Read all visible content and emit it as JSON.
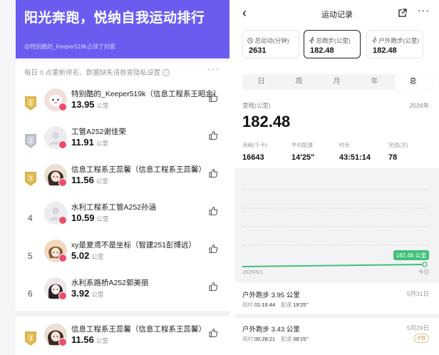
{
  "left": {
    "banner_title": "阳光奔跑，悦纳自我运动排行",
    "banner_sub": "@特别酷的_Keeper519k占领了封面",
    "list_header": "每日 0 点重新排名、数据缺失请核查隐私设置",
    "info_icon": "i",
    "more": "···",
    "medal_labels": [
      "1",
      "2",
      "3"
    ],
    "rows": [
      {
        "rank": "1",
        "name": "特别酷的_Keeper519k（信息工程系王昭金）",
        "value": "13.95",
        "unit": "公里"
      },
      {
        "rank": "2",
        "name": "工管A252谢佳荣",
        "value": "11.91",
        "unit": "公里"
      },
      {
        "rank": "3",
        "name": "信息工程系王蕊馨（信息工程系王蕊馨）",
        "value": "11.56",
        "unit": "公里"
      },
      {
        "rank": "4",
        "name": "水利工程系工管A252孙涵",
        "value": "10.59",
        "unit": "公里"
      },
      {
        "rank": "5",
        "name": "xy是夏鸢不是坐标（智建251彭博远）",
        "value": "5.02",
        "unit": "公里"
      },
      {
        "rank": "6",
        "name": "水利系路桥A252郭美丽",
        "value": "3.92",
        "unit": "公里"
      }
    ],
    "me": {
      "rank": "3",
      "name": "信息工程系王蕊馨（信息工程系王蕊馨）",
      "value": "11.56",
      "unit": "公里"
    },
    "colors": {
      "banner": "#6b5cf0",
      "gold": "#d9b44a",
      "silver": "#b8bcc6",
      "badge": "#ee4d6a"
    }
  },
  "right": {
    "nav": {
      "back": "‹",
      "title": "运动记录",
      "share_icon": "share-icon",
      "more": "···"
    },
    "stats": [
      {
        "label": "总运动(分钟)",
        "value": "2631",
        "icon": "clock-icon"
      },
      {
        "label": "总跑步(公里)",
        "value": "182.48",
        "icon": "runner-icon"
      },
      {
        "label": "户外跑步(公里)",
        "value": "182.48",
        "icon": "runner-icon"
      }
    ],
    "tabs": [
      "日",
      "周",
      "月",
      "年",
      "总"
    ],
    "active_tab": "总",
    "metric": {
      "label": "里程(公里)",
      "year": "2026年",
      "value": "182.48"
    },
    "sub_stats": [
      {
        "label": "消耗(千卡)",
        "value": "16643"
      },
      {
        "label": "平均配速",
        "value": "14'25\""
      },
      {
        "label": "时长",
        "value": "43:51:14"
      },
      {
        "label": "完成(次)",
        "value": "78"
      }
    ],
    "records": [
      {
        "title": "户外跑步 3.95 公里",
        "date": "5月31日",
        "time_label": "用时",
        "time": "01:16:44",
        "pace_label": "配速",
        "pace": "19'25\"",
        "badge": ""
      },
      {
        "title": "户外跑步 3.43 公里",
        "date": "5月29日",
        "time_label": "用时",
        "time": "00:28:21",
        "pace_label": "配速",
        "pace": "08'15\"",
        "badge": "PB"
      }
    ],
    "colors": {
      "line": "#3ec17a",
      "label_bg": "#3ec17a"
    }
  },
  "chart_data": {
    "type": "line",
    "x": [
      "2026/5/1",
      "今日"
    ],
    "series": [
      {
        "values": [
          0,
          182.48
        ]
      }
    ],
    "xlabel": "",
    "ylabel": "",
    "x_tick_labels": [
      "2026/5/1",
      "今日"
    ],
    "value_label": "182.48 公里",
    "grid": true
  }
}
